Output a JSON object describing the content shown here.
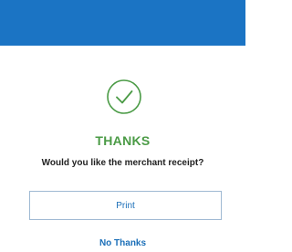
{
  "header": {
    "color": "#1b74c4"
  },
  "status": {
    "icon": "check-circle-icon",
    "color": "#4b9b46",
    "title": "THANKS",
    "prompt": "Would you like the merchant receipt?"
  },
  "actions": {
    "print_label": "Print",
    "no_thanks_label": "No Thanks",
    "accent_color": "#1b6fb8"
  }
}
